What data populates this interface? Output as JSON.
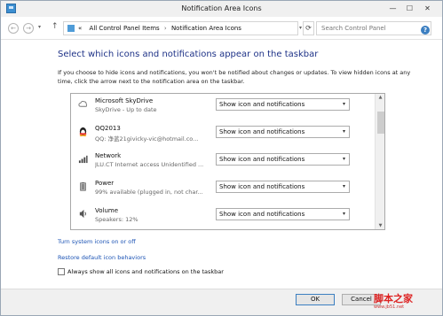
{
  "window": {
    "title": "Notification Area Icons",
    "controls": {
      "minimize": "—",
      "maximize": "☐",
      "close": "✕"
    }
  },
  "address_bar": {
    "back": "←",
    "forward": "→",
    "history_dropdown": "▾",
    "up": "↑",
    "crumbs": [
      "«",
      "All Control Panel Items",
      "›",
      "Notification Area Icons"
    ],
    "dropdown": "▾",
    "refresh": "⟳",
    "search_placeholder": "Search Control Panel",
    "search_glyph": "⌕",
    "help_glyph": "?"
  },
  "main": {
    "heading": "Select which icons and notifications appear on the taskbar",
    "description": "If you choose to hide icons and notifications, you won't be notified about changes or updates. To view hidden icons at any time, click the arrow next to the notification area on the taskbar.",
    "items": [
      {
        "name": "Microsoft SkyDrive",
        "subtitle": "SkyDrive - Up to date",
        "behavior": "Show icon and notifications",
        "icon": "cloud-icon"
      },
      {
        "name": "QQ2013",
        "subtitle": "QQ: 净蓝21givicky-vic@hotmail.co...",
        "behavior": "Show icon and notifications",
        "icon": "penguin-icon"
      },
      {
        "name": "Network",
        "subtitle": "JLU.CT Internet access   Unidentified ...",
        "behavior": "Show icon and notifications",
        "icon": "network-icon"
      },
      {
        "name": "Power",
        "subtitle": "99% available (plugged in, not char...",
        "behavior": "Show icon and notifications",
        "icon": "battery-icon"
      },
      {
        "name": "Volume",
        "subtitle": "Speakers: 12%",
        "behavior": "Show icon and notifications",
        "icon": "speaker-icon"
      }
    ],
    "select_arrow": "▾",
    "scroll_up": "▲",
    "scroll_down": "▼",
    "links": {
      "system_icons": "Turn system icons on or off",
      "restore": "Restore default icon behaviors"
    },
    "always_show_label": "Always show all icons and notifications on the taskbar"
  },
  "footer": {
    "ok_label": "OK",
    "cancel_label": "Cancel",
    "watermark": "脚本之家",
    "watermark_url": "www.jb51.net"
  },
  "colors": {
    "heading": "#1e3287",
    "link": "#1a52b4",
    "accent": "#3c7fc1"
  }
}
